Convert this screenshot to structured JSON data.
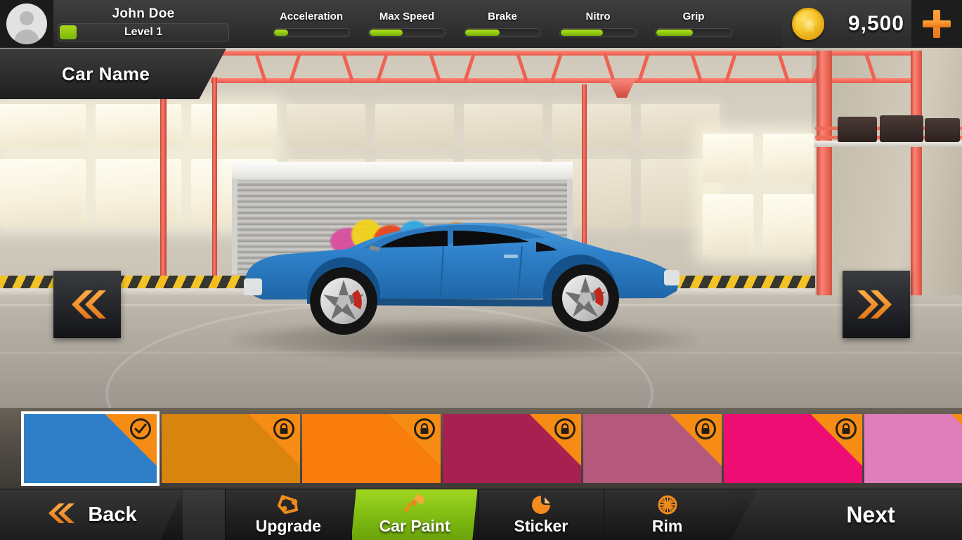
{
  "hud": {
    "avatar_icon": "user-avatar-icon",
    "player_name": "John Doe",
    "level_text": "Level 1",
    "level_progress": 10,
    "stats": [
      {
        "label": "Acceleration",
        "value": 20
      },
      {
        "label": "Max Speed",
        "value": 45
      },
      {
        "label": "Brake",
        "value": 47
      },
      {
        "label": "Nitro",
        "value": 57
      },
      {
        "label": "Grip",
        "value": 50
      }
    ],
    "coin_icon": "coin-icon",
    "coin_count": "9,500",
    "add_currency_icon": "plus-icon"
  },
  "car_panel": {
    "title": "Car Name"
  },
  "viewer": {
    "prev_icon": "double-chevron-left-icon",
    "next_icon": "double-chevron-right-icon",
    "car_body_color": "#2e7fc8",
    "car_rim_color": "#d8d8d8",
    "car_caliper_color": "#c22b22"
  },
  "paint": {
    "selected_index": 0,
    "check_icon": "check-circle-icon",
    "lock_icon": "lock-icon",
    "corner_color": "#f78c14",
    "swatches": [
      {
        "color": "#2e7fc8",
        "locked": false,
        "selected": true
      },
      {
        "color": "#d9840f",
        "locked": true,
        "selected": false
      },
      {
        "color": "#f97d0c",
        "locked": true,
        "selected": false
      },
      {
        "color": "#a6214f",
        "locked": true,
        "selected": false
      },
      {
        "color": "#b4597c",
        "locked": true,
        "selected": false
      },
      {
        "color": "#ee0d72",
        "locked": true,
        "selected": false
      },
      {
        "color": "#e07ebc",
        "locked": true,
        "selected": false
      }
    ]
  },
  "bottom_nav": {
    "back_label": "Back",
    "back_icon": "double-chevron-left-icon",
    "next_label": "Next",
    "active_tab": "Car Paint",
    "tabs": [
      {
        "label": "Upgrade",
        "icon": "engine-belt-icon",
        "active": false
      },
      {
        "label": "Car Paint",
        "icon": "paintbrush-icon",
        "active": true
      },
      {
        "label": "Sticker",
        "icon": "sticker-icon",
        "active": false
      },
      {
        "label": "Rim",
        "icon": "wheel-rim-icon",
        "active": false
      }
    ]
  },
  "theme": {
    "accent_green": "#8fc910",
    "accent_orange": "#f08a1e",
    "panel_dark": "#2b2b2b"
  }
}
